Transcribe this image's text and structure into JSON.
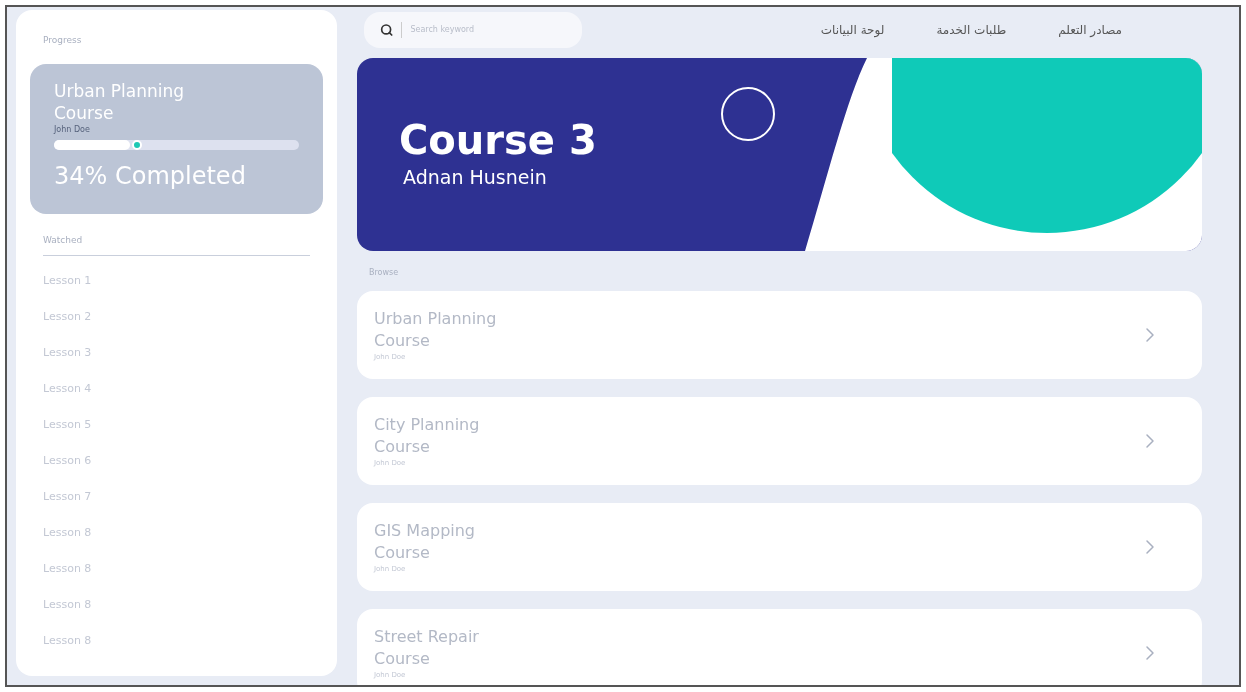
{
  "sidebar": {
    "progress_heading": "Progress",
    "progress_card": {
      "title": "Urban Planning Course",
      "author": "John Doe",
      "level": 0.31,
      "status": "34% Completed"
    },
    "watched_heading": "Watched",
    "lessons": [
      "Lesson 1",
      "Lesson 2",
      "Lesson 3",
      "Lesson 4",
      "Lesson 5",
      "Lesson 6",
      "Lesson 7",
      "Lesson 8",
      "Lesson 8",
      "Lesson 8",
      "Lesson 8"
    ]
  },
  "search": {
    "placeholder": "Search keyword"
  },
  "nav": [
    "مصادر التعلم",
    "طلبات الخدمة",
    "لوحة البيانات"
  ],
  "banner": {
    "title": "Course 3",
    "subtitle": "Adnan Husnein"
  },
  "browse_heading": "Browse",
  "courses": [
    {
      "title": "Urban Planning Course",
      "author": "John Doe"
    },
    {
      "title": "City Planning Course",
      "author": "John Doe"
    },
    {
      "title": "GIS Mapping Course",
      "author": "John Doe"
    },
    {
      "title": "Street Repair Course",
      "author": "John Doe"
    }
  ]
}
